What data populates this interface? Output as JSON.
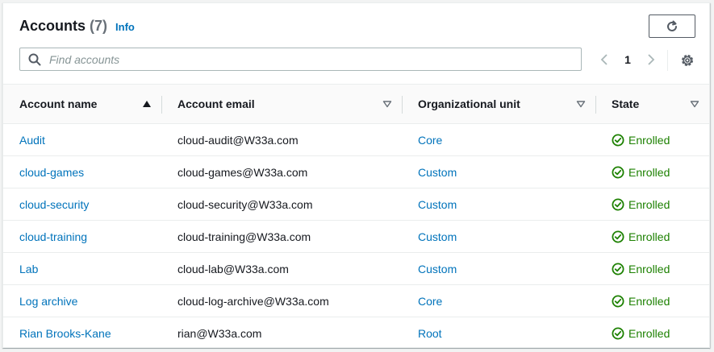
{
  "header": {
    "title": "Accounts",
    "count": "(7)",
    "info_label": "Info"
  },
  "toolbar": {
    "refresh_icon": "refresh-icon",
    "settings_icon": "gear-icon"
  },
  "search": {
    "placeholder": "Find accounts",
    "value": ""
  },
  "pagination": {
    "current_page": "1"
  },
  "table": {
    "columns": [
      {
        "label": "Account name",
        "sort": "ascending"
      },
      {
        "label": "Account email",
        "sort": "none"
      },
      {
        "label": "Organizational unit",
        "sort": "none"
      },
      {
        "label": "State",
        "sort": "none"
      }
    ],
    "rows": [
      {
        "name": "Audit",
        "email": "cloud-audit@W33a.com",
        "ou": "Core",
        "state": "Enrolled"
      },
      {
        "name": "cloud-games",
        "email": "cloud-games@W33a.com",
        "ou": "Custom",
        "state": "Enrolled"
      },
      {
        "name": "cloud-security",
        "email": "cloud-security@W33a.com",
        "ou": "Custom",
        "state": "Enrolled"
      },
      {
        "name": "cloud-training",
        "email": "cloud-training@W33a.com",
        "ou": "Custom",
        "state": "Enrolled"
      },
      {
        "name": "Lab",
        "email": "cloud-lab@W33a.com",
        "ou": "Custom",
        "state": "Enrolled"
      },
      {
        "name": "Log archive",
        "email": "cloud-log-archive@W33a.com",
        "ou": "Core",
        "state": "Enrolled"
      },
      {
        "name": "Rian Brooks-Kane",
        "email": "rian@W33a.com",
        "ou": "Root",
        "state": "Enrolled"
      }
    ]
  },
  "colors": {
    "link": "#0073bb",
    "success": "#1d8102",
    "text": "#16191f",
    "muted": "#687078"
  }
}
